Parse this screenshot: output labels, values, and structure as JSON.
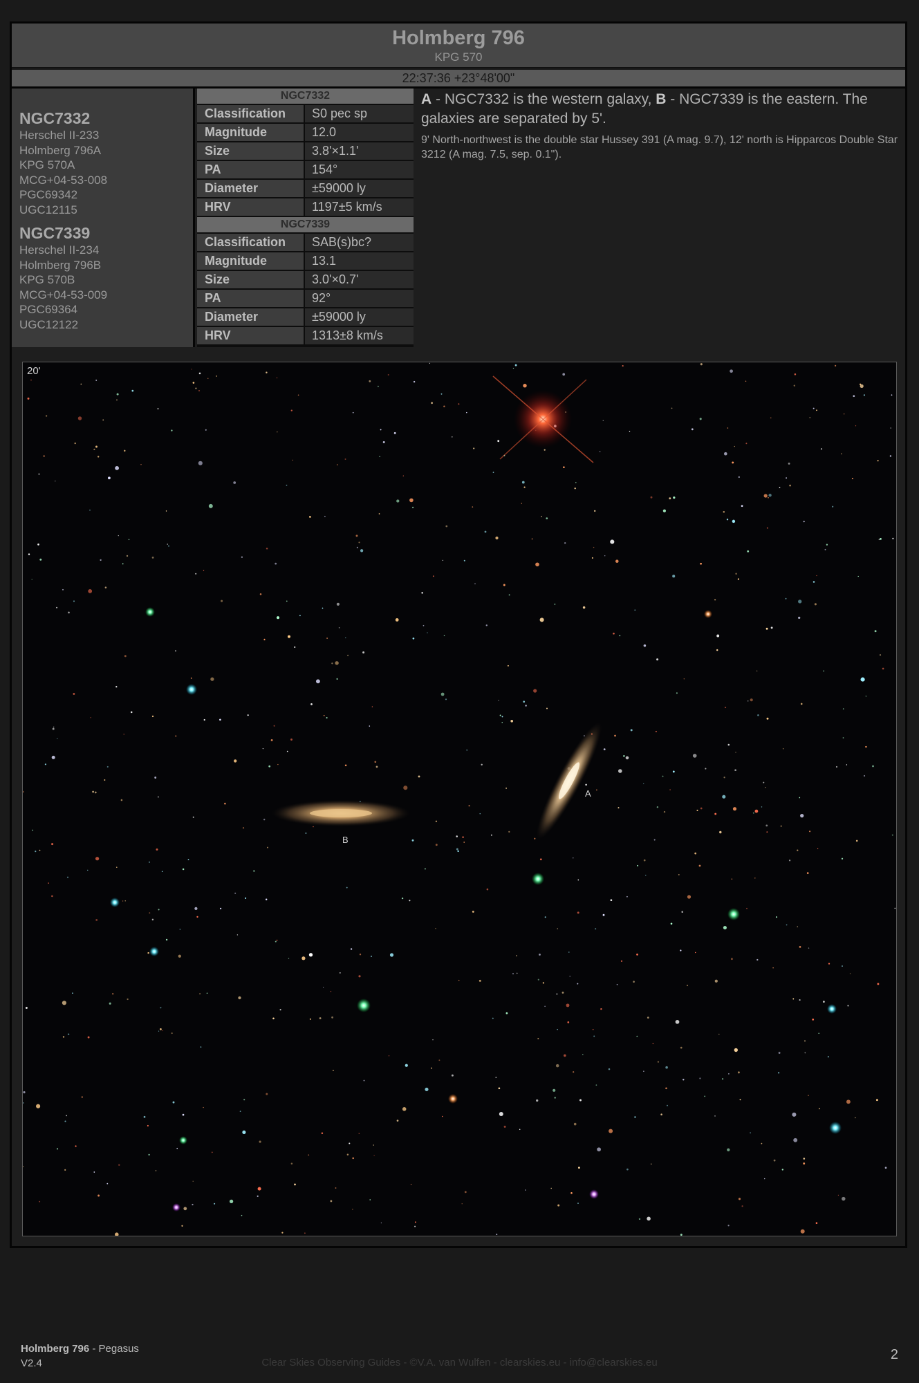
{
  "header": {
    "title": "Holmberg 796",
    "subtitle": "KPG 570",
    "coords": "22:37:36 +23°48'00\""
  },
  "objects": [
    {
      "name": "NGC7332",
      "aliases": [
        "Herschel II-233",
        "Holmberg 796A",
        "KPG 570A",
        "MCG+04-53-008",
        "PGC69342",
        "UGC12115"
      ]
    },
    {
      "name": "NGC7339",
      "aliases": [
        "Herschel II-234",
        "Holmberg 796B",
        "KPG 570B",
        "MCG+04-53-009",
        "PGC69364",
        "UGC12122"
      ]
    }
  ],
  "tables": [
    {
      "title": "NGC7332",
      "rows": [
        {
          "k": "Classification",
          "v": "S0 pec sp"
        },
        {
          "k": "Magnitude",
          "v": "12.0"
        },
        {
          "k": "Size",
          "v": "3.8'×1.1'"
        },
        {
          "k": "PA",
          "v": "154°"
        },
        {
          "k": "Diameter",
          "v": "±59000 ly"
        },
        {
          "k": "HRV",
          "v": "1197±5 km/s"
        }
      ]
    },
    {
      "title": "NGC7339",
      "rows": [
        {
          "k": "Classification",
          "v": "SAB(s)bc?"
        },
        {
          "k": "Magnitude",
          "v": "13.1"
        },
        {
          "k": "Size",
          "v": "3.0'×0.7'"
        },
        {
          "k": "PA",
          "v": "92°"
        },
        {
          "k": "Diameter",
          "v": "±59000 ly"
        },
        {
          "k": "HRV",
          "v": "1313±8 km/s"
        }
      ]
    }
  ],
  "description": {
    "a_letter": "A",
    "a_text": " - NGC7332 is the western galaxy, ",
    "b_letter": "B",
    "b_text": " - NGC7339 is the eastern. The galaxies are separated by 5'.",
    "notes": "9' North-northwest is the double star Hussey 391 (A mag. 9.7), 12' north is Hipparcos Double Star 3212 (A mag. 7.5, sep. 0.1\")."
  },
  "image": {
    "scale": "20'",
    "label_a": "A",
    "label_b": "B"
  },
  "footer": {
    "name": "Holmberg 796",
    "constellation": " - Pegasus",
    "version": "V2.4",
    "credit": "Clear Skies Observing Guides - ©V.A. van Wulfen - clearskies.eu - info@clearskies.eu",
    "page": "2"
  }
}
